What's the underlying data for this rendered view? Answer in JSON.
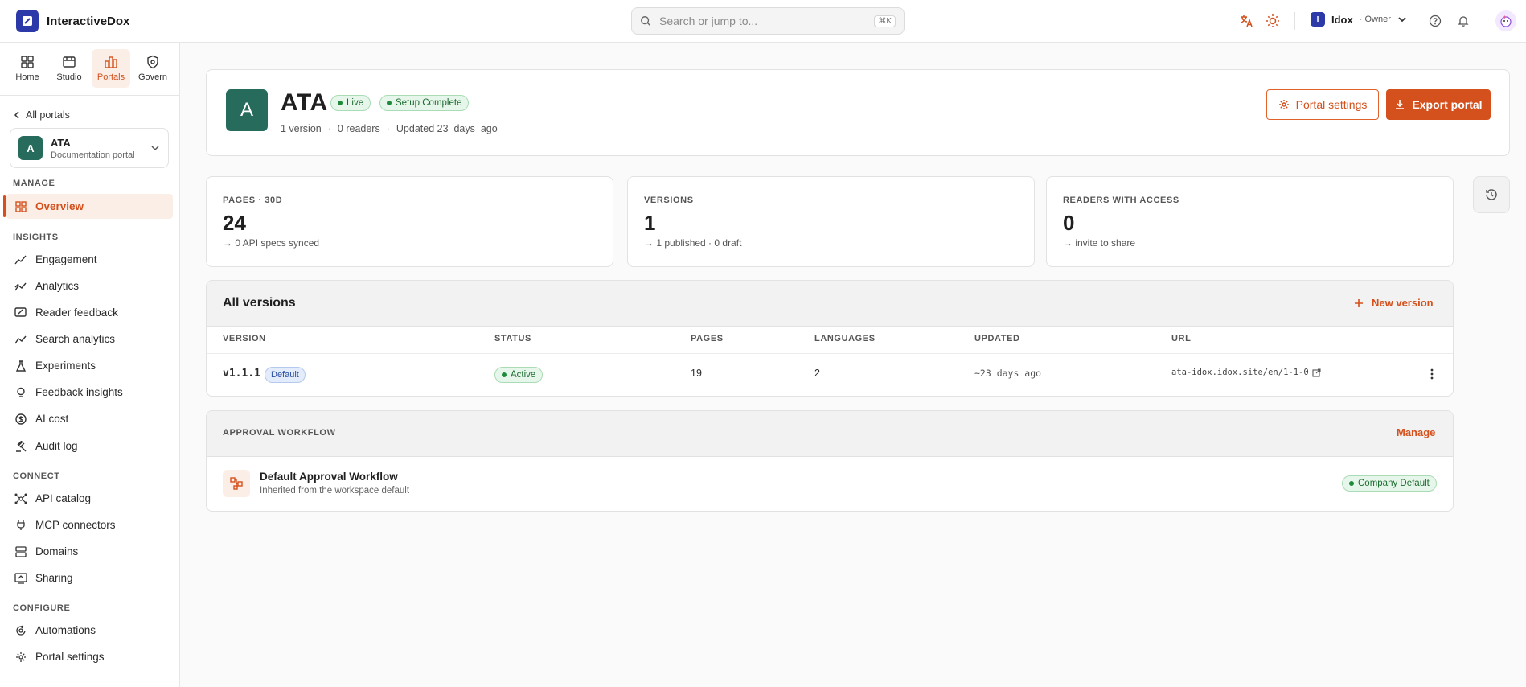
{
  "app": {
    "name": "InteractiveDox"
  },
  "search": {
    "placeholder": "Search or jump to...",
    "shortcut": "⌘K"
  },
  "workspace": {
    "badge": "I",
    "name": "Idox",
    "role": "· Owner"
  },
  "modules": [
    {
      "label": "Home",
      "icon": "home-icon"
    },
    {
      "label": "Studio",
      "icon": "studio-icon"
    },
    {
      "label": "Portals",
      "icon": "portals-icon",
      "active": true
    },
    {
      "label": "Govern",
      "icon": "shield-icon"
    }
  ],
  "sidebar": {
    "back_label": "All portals",
    "portal": {
      "avatar": "A",
      "name": "ATA",
      "subtitle": "Documentation portal"
    },
    "sections": {
      "manage": "MANAGE",
      "insights": "INSIGHTS",
      "connect": "CONNECT",
      "configure": "CONFIGURE"
    },
    "items": {
      "overview": "Overview",
      "engagement": "Engagement",
      "analytics": "Analytics",
      "reader_feedback": "Reader feedback",
      "search_analytics": "Search analytics",
      "experiments": "Experiments",
      "feedback_insights": "Feedback insights",
      "ai_cost": "AI cost",
      "audit_log": "Audit log",
      "api_catalog": "API catalog",
      "mcp_connectors": "MCP connectors",
      "domains": "Domains",
      "sharing": "Sharing",
      "automations": "Automations",
      "portal_settings": "Portal settings"
    }
  },
  "portal": {
    "avatar": "A",
    "title": "ATA",
    "live_badge": "Live",
    "setup_badge": "Setup Complete",
    "meta": {
      "versions": "1 version",
      "readers": "0 readers",
      "updated": "Updated 23  days  ago"
    },
    "settings_button": "Portal settings",
    "export_button": "Export portal"
  },
  "stats": [
    {
      "label": "PAGES · 30D",
      "value": "24",
      "note": "→ 0 API specs synced"
    },
    {
      "label": "VERSIONS",
      "value": "1",
      "note": "→ 1 published · 0 draft"
    },
    {
      "label": "READERS WITH ACCESS",
      "value": "0",
      "note": "→ invite to share"
    }
  ],
  "versions": {
    "title": "All versions",
    "new_button": "New version",
    "columns": [
      "VERSION",
      "STATUS",
      "PAGES",
      "LANGUAGES",
      "UPDATED",
      "URL"
    ],
    "rows": [
      {
        "version": "v1.1.1",
        "default_tag": "Default",
        "status": "Active",
        "pages": "19",
        "languages": "2",
        "updated": "~23 days ago",
        "url": "ata-idox.idox.site/en/1-1-0"
      }
    ]
  },
  "workflow": {
    "label": "APPROVAL WORKFLOW",
    "manage": "Manage",
    "name": "Default Approval Workflow",
    "subtitle": "Inherited from the workspace default",
    "badge": "Company Default"
  },
  "colors": {
    "accent": "#d4501c",
    "brand": "#2b3aa8",
    "portal_avatar": "#266b5b",
    "success": "#1f8a3c"
  }
}
